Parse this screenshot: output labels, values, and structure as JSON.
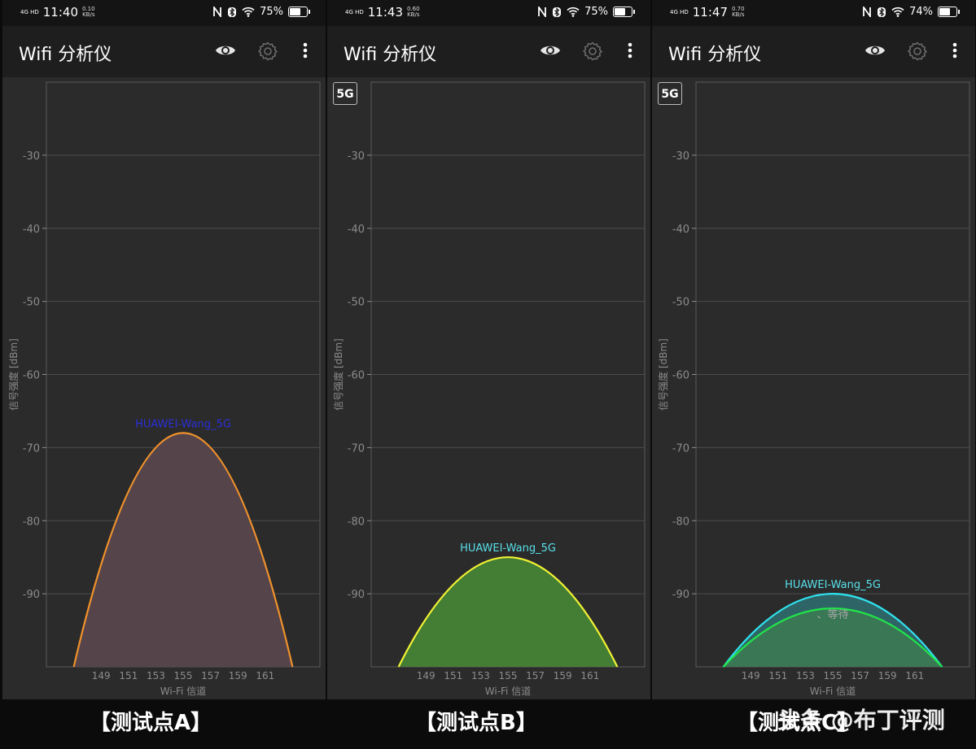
{
  "app": {
    "title": "Wifi 分析仪"
  },
  "panels": [
    {
      "status": {
        "network": "4G HD",
        "time": "11:40",
        "speed": "0.10",
        "speed_unit": "KB/s",
        "battery": "75%",
        "battery_level": 0.75
      },
      "band_badge": ""
    },
    {
      "status": {
        "network": "4G HD",
        "time": "11:43",
        "speed": "0.60",
        "speed_unit": "KB/s",
        "battery": "75%",
        "battery_level": 0.75
      },
      "band_badge": "5G"
    },
    {
      "status": {
        "network": "4G HD",
        "time": "11:47",
        "speed": "0.70",
        "speed_unit": "KB/s",
        "battery": "74%",
        "battery_level": 0.74
      },
      "band_badge": "5G"
    }
  ],
  "captions": [
    "【测试点A】",
    "【测试点B】",
    "【测试点C】"
  ],
  "watermark": "头条 @布丁评测",
  "icons": [
    "eye-icon",
    "gear-icon",
    "more-vert-icon",
    "nfc-icon",
    "bluetooth-icon",
    "wifi-icon",
    "battery-icon"
  ],
  "colors": {
    "panel_bg": "#2b2b2b",
    "appbar_bg": "#1e1e1e",
    "grid": "#4d4d4d",
    "axis_text": "#8c8c8c"
  },
  "chart_data": [
    {
      "type": "area",
      "xlabel": "Wi-Fi 信道",
      "ylabel": "信号强度 [dBm]",
      "x_ticks": [
        149,
        151,
        153,
        155,
        157,
        159,
        161
      ],
      "y_ticks": [
        -30,
        -40,
        -50,
        -60,
        -70,
        -80,
        -90
      ],
      "xlim": [
        145,
        165
      ],
      "ylim": [
        -100,
        -20
      ],
      "series": [
        {
          "name": "HUAWEI-Wang_5G",
          "center_channel": 155,
          "width_channels": 16,
          "peak": -68,
          "stroke": "#f0922b",
          "fill": "#56444b",
          "label_color": "#2b2fd8"
        }
      ]
    },
    {
      "type": "area",
      "xlabel": "Wi-Fi 信道",
      "ylabel": "信号强度 [dBm]",
      "x_ticks": [
        149,
        151,
        153,
        155,
        157,
        159,
        161
      ],
      "y_ticks": [
        -30,
        -40,
        -50,
        -60,
        -70,
        -80,
        -90
      ],
      "xlim": [
        145,
        165
      ],
      "ylim": [
        -100,
        -20
      ],
      "series": [
        {
          "name": "HUAWEI-Wang_5G",
          "center_channel": 155,
          "width_channels": 16,
          "peak": -85,
          "stroke": "#f2f233",
          "fill": "#447e35",
          "label_color": "#58e0ea"
        }
      ]
    },
    {
      "type": "area",
      "xlabel": "Wi-Fi 信道",
      "ylabel": "信号强度 [dBm]",
      "x_ticks": [
        149,
        151,
        153,
        155,
        157,
        159,
        161
      ],
      "y_ticks": [
        -30,
        -40,
        -50,
        -60,
        -70,
        -80,
        -90
      ],
      "xlim": [
        145,
        165
      ],
      "ylim": [
        -100,
        -20
      ],
      "series": [
        {
          "name": "HUAWEI-Wang_5G",
          "center_channel": 155,
          "width_channels": 16,
          "peak": -90,
          "stroke": "#2fe2ee",
          "fill": "#2f6466",
          "label_color": "#58e0ea"
        },
        {
          "name": "、等待",
          "center_channel": 155,
          "width_channels": 16,
          "peak": -92,
          "stroke": "#22e44a",
          "fill": "#3b7a52",
          "label_color": "#a9a9a9"
        }
      ]
    }
  ]
}
